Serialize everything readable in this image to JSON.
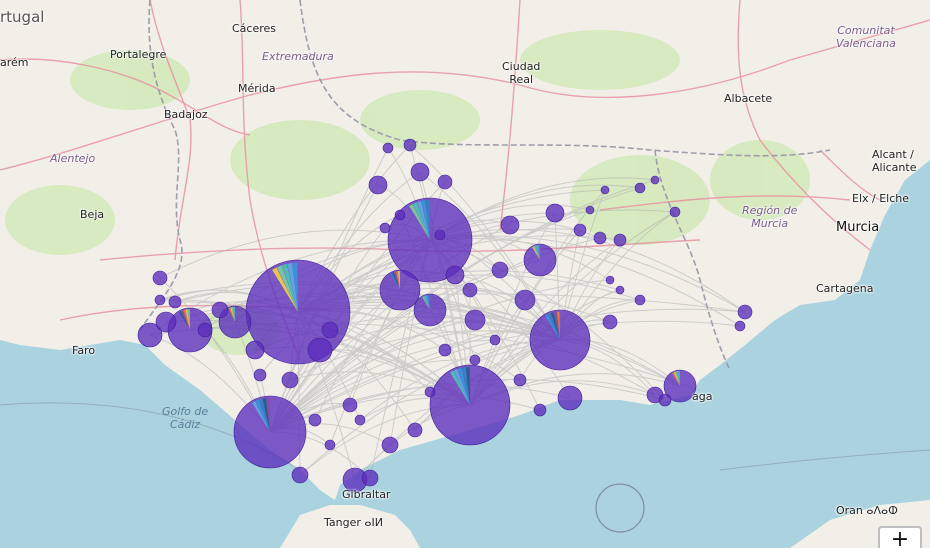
{
  "map": {
    "country_labels": [
      "rtugal"
    ],
    "region_labels": [
      "Extremadura",
      "Alentejo",
      "Región de\nMurcia",
      "Comunitat\nValenciana"
    ],
    "sea_labels": [
      "Golfo de\nCádiz"
    ],
    "city_labels": [
      "Cáceres",
      "Portalegre",
      "arém",
      "Mérida",
      "Badajoz",
      "Beja",
      "Faro",
      "Ciudad\nReal",
      "Albacete",
      "Alcant /\nAlicante",
      "Elx / Elche",
      "Murcia",
      "Cartagena",
      "Gibraltar",
      "Tanger ⴰⵏⵍ",
      "Oran ⴰⴷⴰⵀ",
      "aga"
    ],
    "zoom_in_label": "+"
  },
  "colors": {
    "land": "#f2efe9",
    "water": "#aad3df",
    "bubble": "#5b2dbd",
    "flow": "#b0b0b0",
    "road_major": "#e892a2",
    "road_minor": "#f7fabf",
    "border": "#9e9cab"
  },
  "layers": {
    "flow_lines": "origin-destination flows (grey)",
    "bubbles": "proportional pie-chart markers (purple)"
  }
}
